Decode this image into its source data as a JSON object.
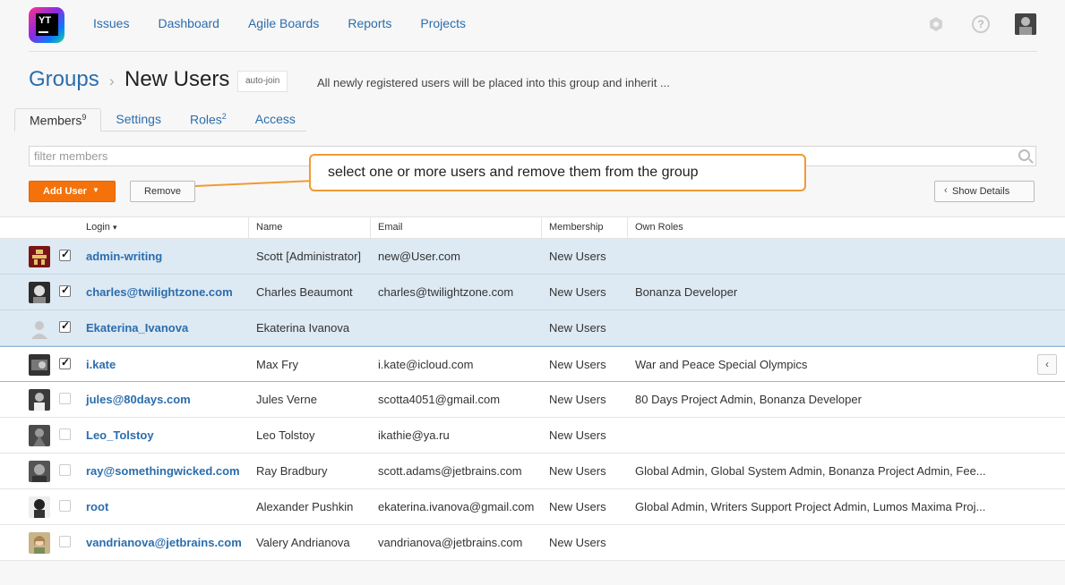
{
  "app": {
    "logo_text": "YT",
    "nav": [
      "Issues",
      "Dashboard",
      "Agile Boards",
      "Reports",
      "Projects"
    ],
    "help_glyph": "?"
  },
  "page": {
    "breadcrumb_root": "Groups",
    "breadcrumb_sep": "›",
    "title": "New Users",
    "badge": "auto-join",
    "description": "All newly registered users will be placed into this group and inherit ..."
  },
  "tabs": [
    {
      "label": "Members",
      "count": "9"
    },
    {
      "label": "Settings",
      "count": ""
    },
    {
      "label": "Roles",
      "count": "2"
    },
    {
      "label": "Access",
      "count": ""
    }
  ],
  "filter": {
    "placeholder": "filter members"
  },
  "toolbar": {
    "add_user": "Add User",
    "add_caret": "▼",
    "remove": "Remove",
    "show_details": "Show Details",
    "details_chevron": "‹"
  },
  "callout": "select one or more users and remove them from the group",
  "table": {
    "headers": {
      "login": "Login",
      "sort_caret": "▾",
      "name": "Name",
      "email": "Email",
      "membership": "Membership",
      "own_roles": "Own Roles"
    },
    "row_arrow": "‹",
    "rows": [
      {
        "login": "admin-writing",
        "name": "Scott [Administrator]",
        "email": "new@User.com",
        "membership": "New Users",
        "roles": "",
        "checked": true
      },
      {
        "login": "charles@twilightzone.com",
        "name": "Charles Beaumont",
        "email": "charles@twilightzone.com",
        "membership": "New Users",
        "roles": "Bonanza Developer",
        "checked": true
      },
      {
        "login": "Ekaterina_Ivanova",
        "name": "Ekaterina Ivanova",
        "email": "",
        "membership": "New Users",
        "roles": "",
        "checked": true
      },
      {
        "login": "i.kate",
        "name": "Max Fry",
        "email": "i.kate@icloud.com",
        "membership": "New Users",
        "roles": "War and Peace Special Olympics",
        "checked": true
      },
      {
        "login": "jules@80days.com",
        "name": "Jules Verne",
        "email": "scotta4051@gmail.com",
        "membership": "New Users",
        "roles": "80 Days Project Admin, Bonanza Developer",
        "checked": false
      },
      {
        "login": "Leo_Tolstoy",
        "name": "Leo Tolstoy",
        "email": "ikathie@ya.ru",
        "membership": "New Users",
        "roles": "",
        "checked": false
      },
      {
        "login": "ray@somethingwicked.com",
        "name": "Ray Bradbury",
        "email": "scott.adams@jetbrains.com",
        "membership": "New Users",
        "roles": "Global Admin, Global System Admin, Bonanza Project Admin, Fee...",
        "checked": false
      },
      {
        "login": "root",
        "name": "Alexander Pushkin",
        "email": "ekaterina.ivanova@gmail.com",
        "membership": "New Users",
        "roles": "Global Admin, Writers Support Project Admin, Lumos Maxima Proj...",
        "checked": false
      },
      {
        "login": "vandrianova@jetbrains.com",
        "name": "Valery Andrianova",
        "email": "vandrianova@jetbrains.com",
        "membership": "New Users",
        "roles": "",
        "checked": false
      }
    ]
  }
}
